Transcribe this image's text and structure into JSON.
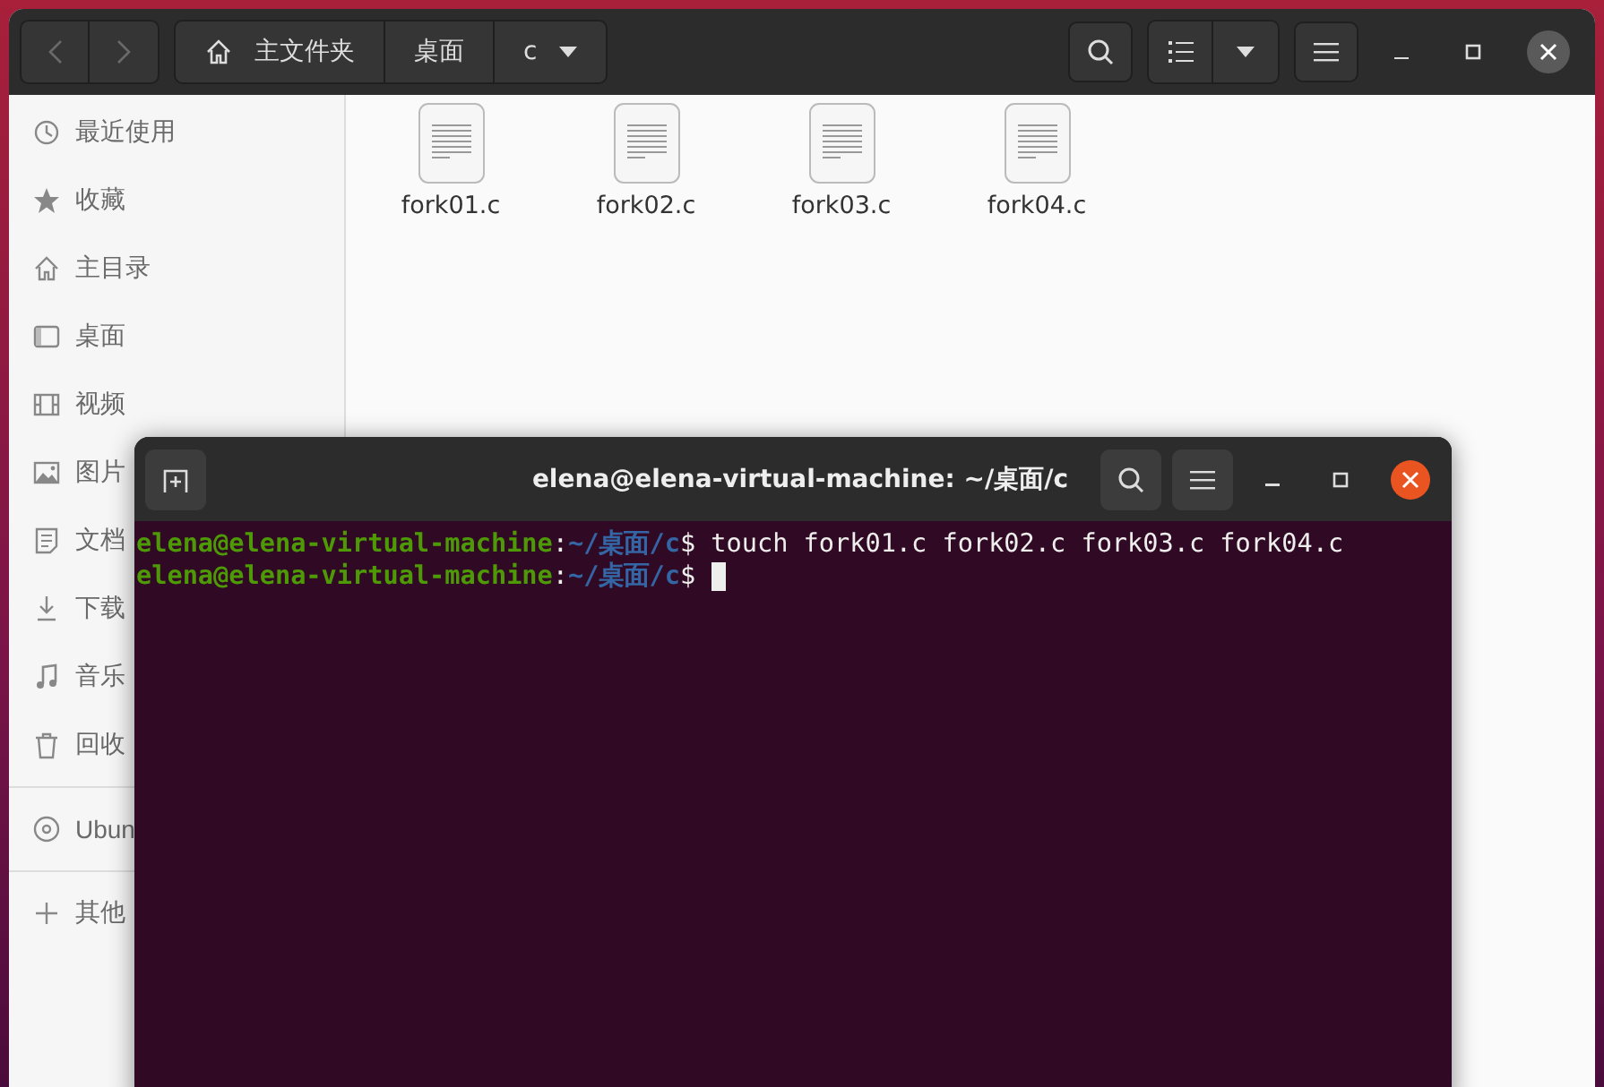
{
  "file_manager": {
    "path": [
      {
        "label": "主文件夹",
        "kind": "home"
      },
      {
        "label": "桌面",
        "kind": "folder"
      },
      {
        "label": "c",
        "kind": "dropdown"
      }
    ],
    "sidebar": {
      "sections": [
        {
          "items": [
            {
              "label": "最近使用"
            },
            {
              "label": "收藏"
            },
            {
              "label": "主目录"
            },
            {
              "label": "桌面"
            },
            {
              "label": "视频"
            },
            {
              "label": "图片"
            },
            {
              "label": "文档"
            },
            {
              "label": "下载"
            },
            {
              "label": "音乐"
            },
            {
              "label": "回收"
            }
          ]
        },
        {
          "items": [
            {
              "label": "Ubun"
            }
          ]
        },
        {
          "items": [
            {
              "label": "其他"
            }
          ]
        }
      ]
    },
    "files": [
      {
        "name": "fork01.c"
      },
      {
        "name": "fork02.c"
      },
      {
        "name": "fork03.c"
      },
      {
        "name": "fork04.c"
      }
    ]
  },
  "terminal": {
    "title": "elena@elena-virtual-machine: ~/桌面/c",
    "lines": [
      {
        "user": "elena@elena-virtual-machine",
        "separator": ":",
        "path": "~/桌面/c",
        "prompt": "$",
        "command": "touch fork01.c fork02.c fork03.c fork04.c",
        "cursor": false
      },
      {
        "user": "elena@elena-virtual-machine",
        "separator": ":",
        "path": "~/桌面/c",
        "prompt": "$",
        "cursor": true
      }
    ]
  }
}
